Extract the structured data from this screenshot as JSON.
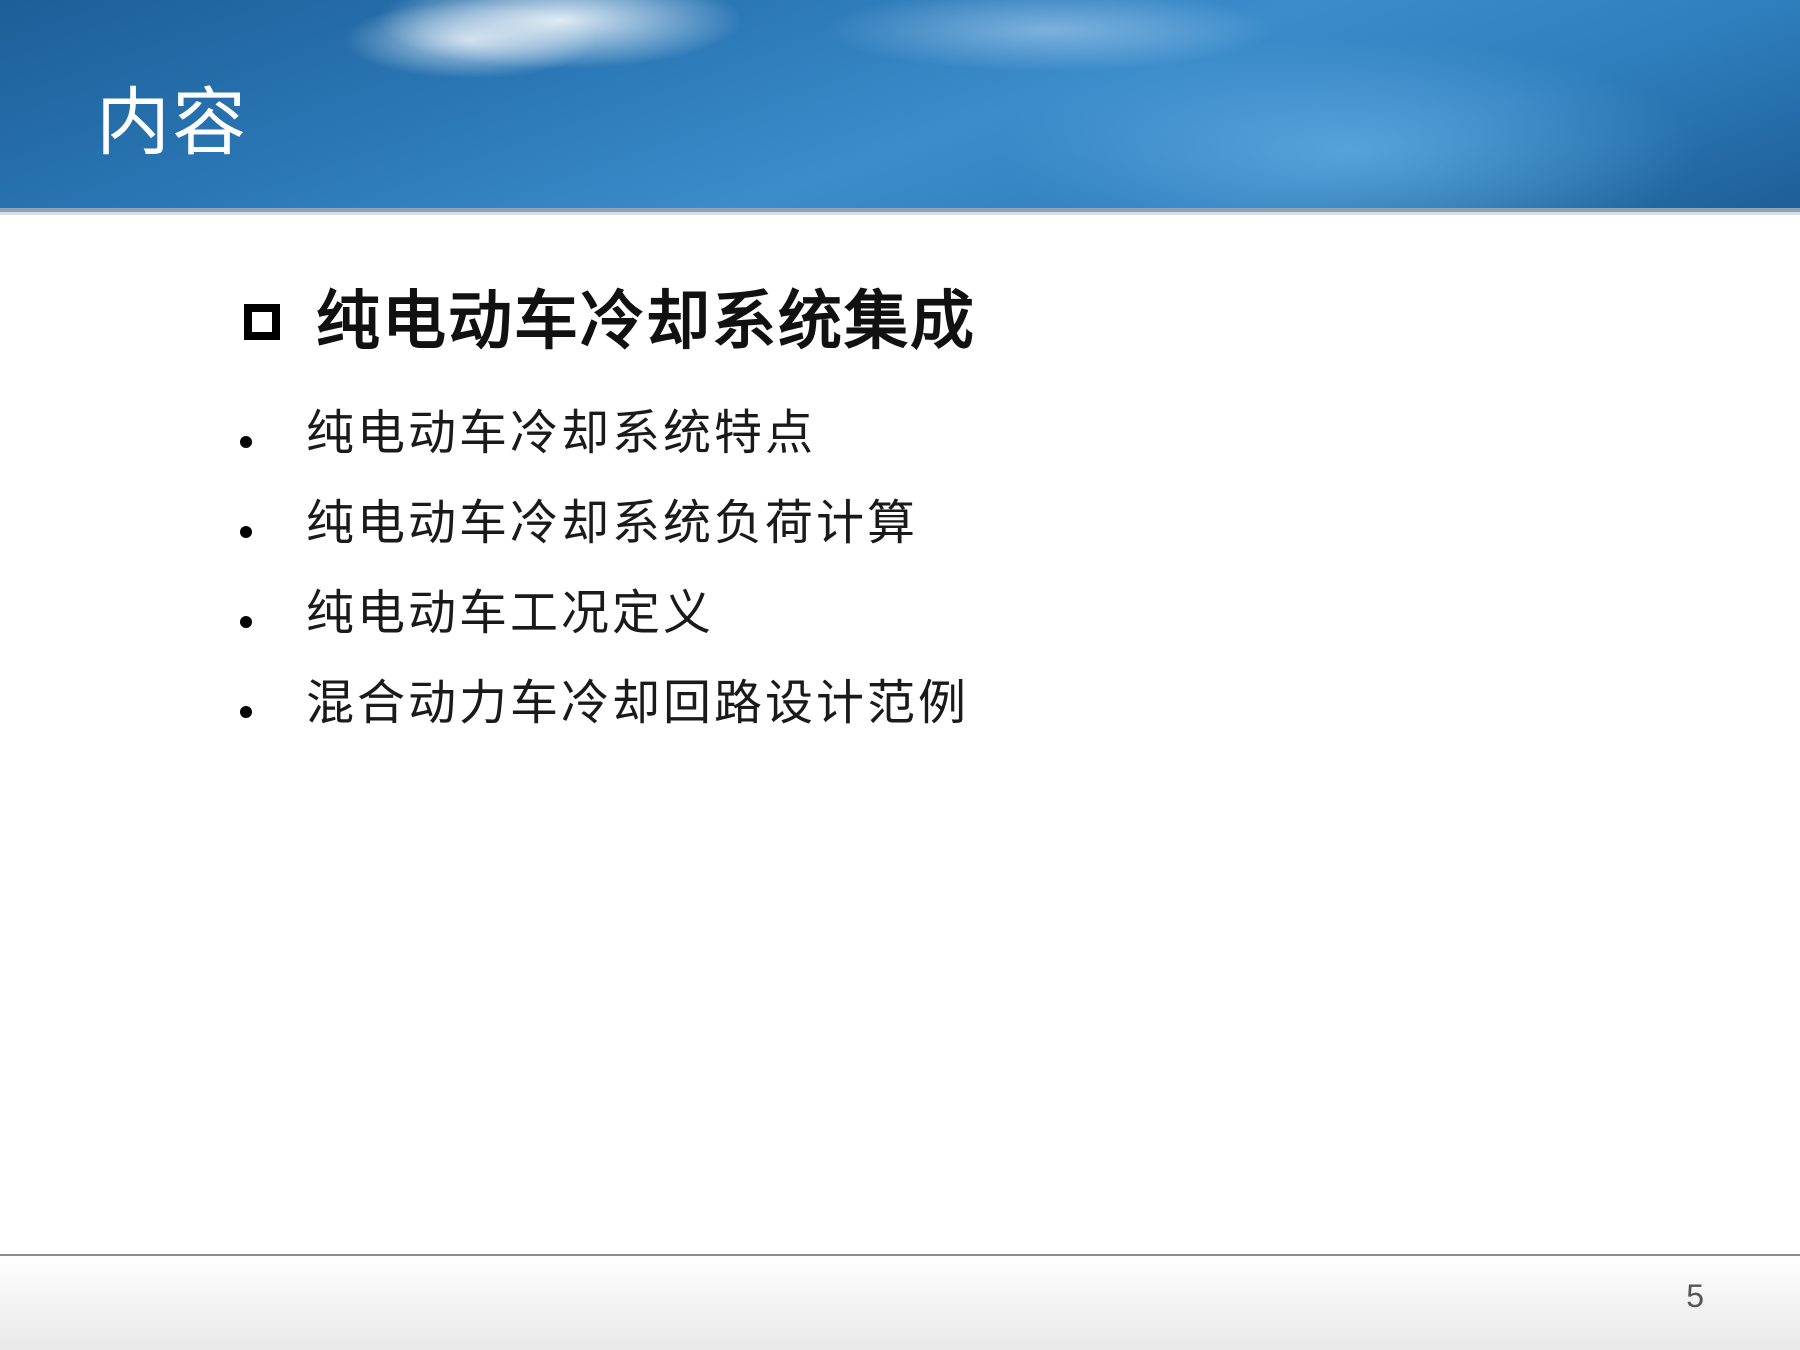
{
  "slide": {
    "title": "内容",
    "section_heading": "纯电动车冷却系统集成",
    "items": [
      {
        "label": "纯电动车冷却系统特点"
      },
      {
        "label": "纯电动车冷却系统负荷计算"
      },
      {
        "label": "纯电动车工况定义"
      },
      {
        "label": "混合动力车冷却回路设计范例"
      }
    ],
    "page_number": "5"
  },
  "colors": {
    "banner_dark": "#1c5f98",
    "banner_light": "#3b8ccb",
    "text": "#111111"
  },
  "icons": {
    "section_marker": "checkbox-icon",
    "list_marker": "bullet-icon"
  }
}
